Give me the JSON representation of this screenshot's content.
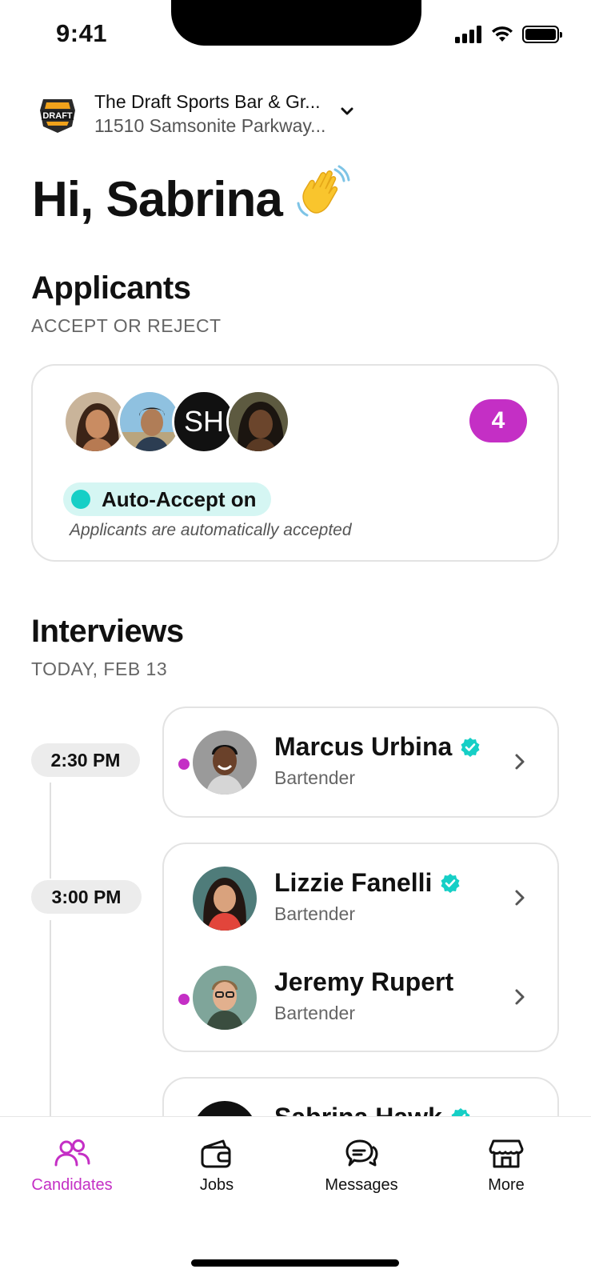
{
  "status_bar": {
    "time": "9:41"
  },
  "venue": {
    "name": "The Draft Sports Bar & Gr...",
    "address": "11510 Samsonite Parkway...",
    "logo_text": "DRAFT"
  },
  "greeting": {
    "text": "Hi, Sabrina",
    "emoji": "👋"
  },
  "applicants": {
    "title": "Applicants",
    "subtitle": "ACCEPT OR REJECT",
    "avatars": [
      {
        "type": "photo"
      },
      {
        "type": "photo"
      },
      {
        "type": "initials",
        "initials": "SH"
      },
      {
        "type": "photo"
      }
    ],
    "count": "4",
    "auto_accept_label": "Auto-Accept on",
    "auto_accept_description": "Applicants are automatically accepted"
  },
  "interviews": {
    "title": "Interviews",
    "date": "TODAY, FEB 13",
    "slots": [
      {
        "time": "2:30 PM",
        "people": [
          {
            "name": "Marcus Urbina",
            "role": "Bartender",
            "verified": true,
            "unread": true
          }
        ]
      },
      {
        "time": "3:00 PM",
        "people": [
          {
            "name": "Lizzie Fanelli",
            "role": "Bartender",
            "verified": true,
            "unread": false
          },
          {
            "name": "Jeremy Rupert",
            "role": "Bartender",
            "verified": false,
            "unread": true
          }
        ]
      },
      {
        "time": "",
        "people": [
          {
            "name": "Sabrina Hawk",
            "role": "",
            "verified": true,
            "unread": false
          }
        ]
      }
    ]
  },
  "tabbar": {
    "tabs": [
      {
        "label": "Candidates",
        "icon": "candidates-icon",
        "active": true
      },
      {
        "label": "Jobs",
        "icon": "wallet-icon",
        "active": false
      },
      {
        "label": "Messages",
        "icon": "messages-icon",
        "active": false
      },
      {
        "label": "More",
        "icon": "store-icon",
        "active": false
      }
    ]
  },
  "colors": {
    "accent": "#c42fc5",
    "teal": "#16cfc6",
    "teal_bg": "#d5f6f3"
  }
}
